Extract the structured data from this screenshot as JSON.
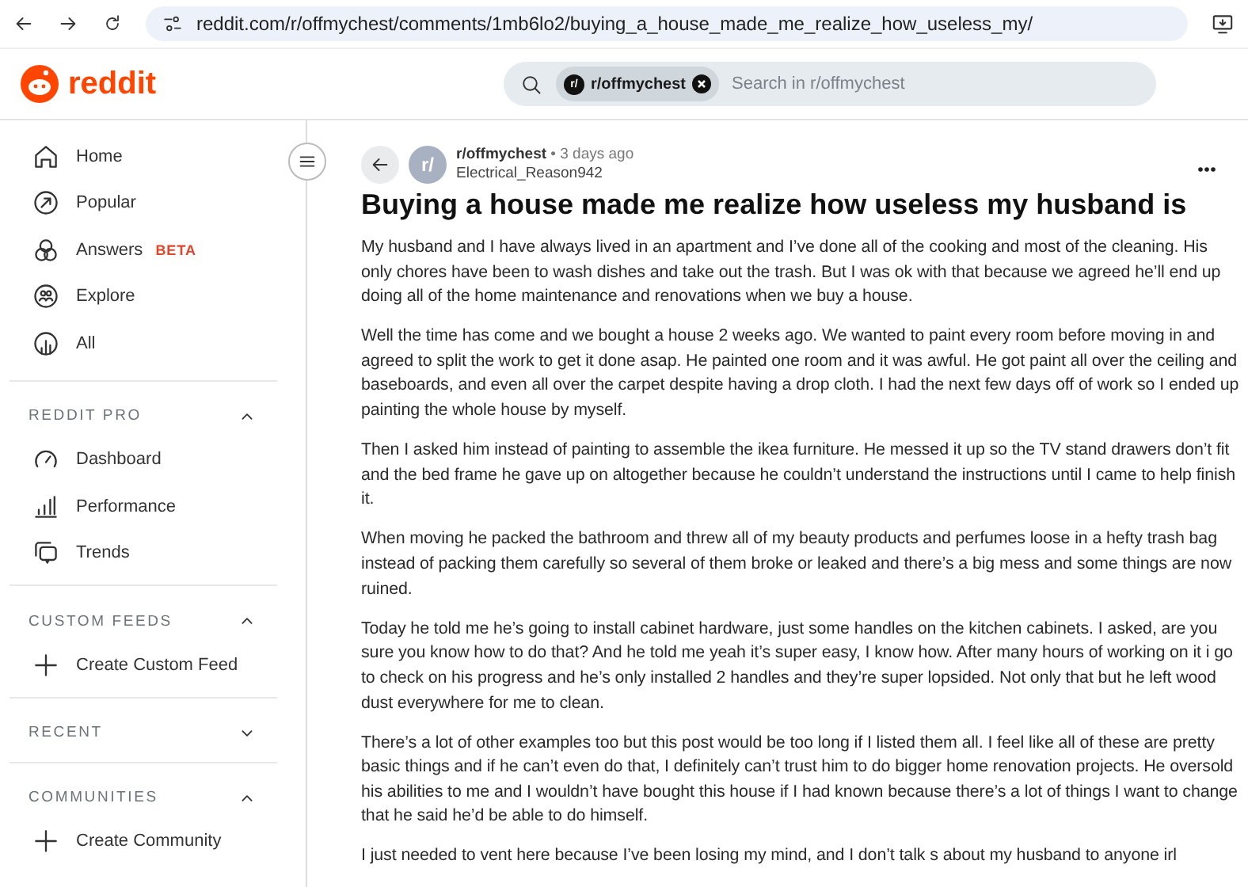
{
  "browser": {
    "url": "reddit.com/r/offmychest/comments/1mb6lo2/buying_a_house_made_me_realize_how_useless_my/"
  },
  "header": {
    "logo": "reddit",
    "search_chip": "r/offmychest",
    "search_chip_icon": "r/",
    "search_placeholder": "Search in r/offmychest"
  },
  "sidebar": {
    "items": [
      {
        "label": "Home"
      },
      {
        "label": "Popular"
      },
      {
        "label": "Answers",
        "badge": "BETA"
      },
      {
        "label": "Explore"
      },
      {
        "label": "All"
      }
    ],
    "sections": [
      {
        "title": "REDDIT PRO",
        "expanded": true,
        "items": [
          {
            "label": "Dashboard"
          },
          {
            "label": "Performance"
          },
          {
            "label": "Trends"
          }
        ]
      },
      {
        "title": "CUSTOM FEEDS",
        "expanded": true,
        "items": [
          {
            "label": "Create Custom Feed"
          }
        ]
      },
      {
        "title": "RECENT",
        "expanded": false
      },
      {
        "title": "COMMUNITIES",
        "expanded": true,
        "items": [
          {
            "label": "Create Community"
          }
        ]
      }
    ]
  },
  "post": {
    "avatar": "r/",
    "subreddit": "r/offmychest",
    "time": "• 3 days ago",
    "author": "Electrical_Reason942",
    "title": "Buying a house made me realize how useless my husband is",
    "paragraphs": [
      "My husband and I have always lived in an apartment and I’ve done all of the cooking and most of the cleaning. His only chores have been to wash dishes and take out the trash. But I was ok with that because we agreed he’ll end up doing all of the home maintenance and renovations when we buy a house.",
      "Well the time has come and we bought a house 2 weeks ago. We wanted to paint every room before moving in and agreed to split the work to get it done asap. He painted one room and it was awful. He got paint all over the ceiling and baseboards, and even all over the carpet despite having a drop cloth. I had the next few days off of work so I ended up painting the whole house by myself.",
      "Then I asked him instead of painting to assemble the ikea furniture. He messed it up so the TV stand drawers don’t fit and the bed frame he gave up on altogether because he couldn’t understand the instructions until I came to help finish it.",
      "When moving he packed the bathroom and threw all of my beauty products and perfumes loose in a hefty trash bag instead of packing them carefully so several of them broke or leaked and there’s a big mess and some things are now ruined.",
      "Today he told me he’s going to install cabinet hardware, just some handles on the kitchen cabinets. I asked, are you sure you know how to do that? And he told me yeah it’s super easy, I know how. After many hours of working on it i go to check on his progress and he’s only installed 2 handles and they’re super lopsided. Not only that but he left wood dust everywhere for me to clean.",
      "There’s a lot of other examples too but this post would be too long if I listed them all. I feel like all of these are pretty basic things and if he can’t even do that, I definitely can’t trust him to do bigger home renovation projects. He oversold his abilities to me and I wouldn’t have bought this house if I had known because there’s a lot of things I want to change that he said he’d be able to do himself.",
      "I just needed to vent here because I’ve been losing my mind, and I don’t talk s about my husband to anyone irl"
    ]
  }
}
